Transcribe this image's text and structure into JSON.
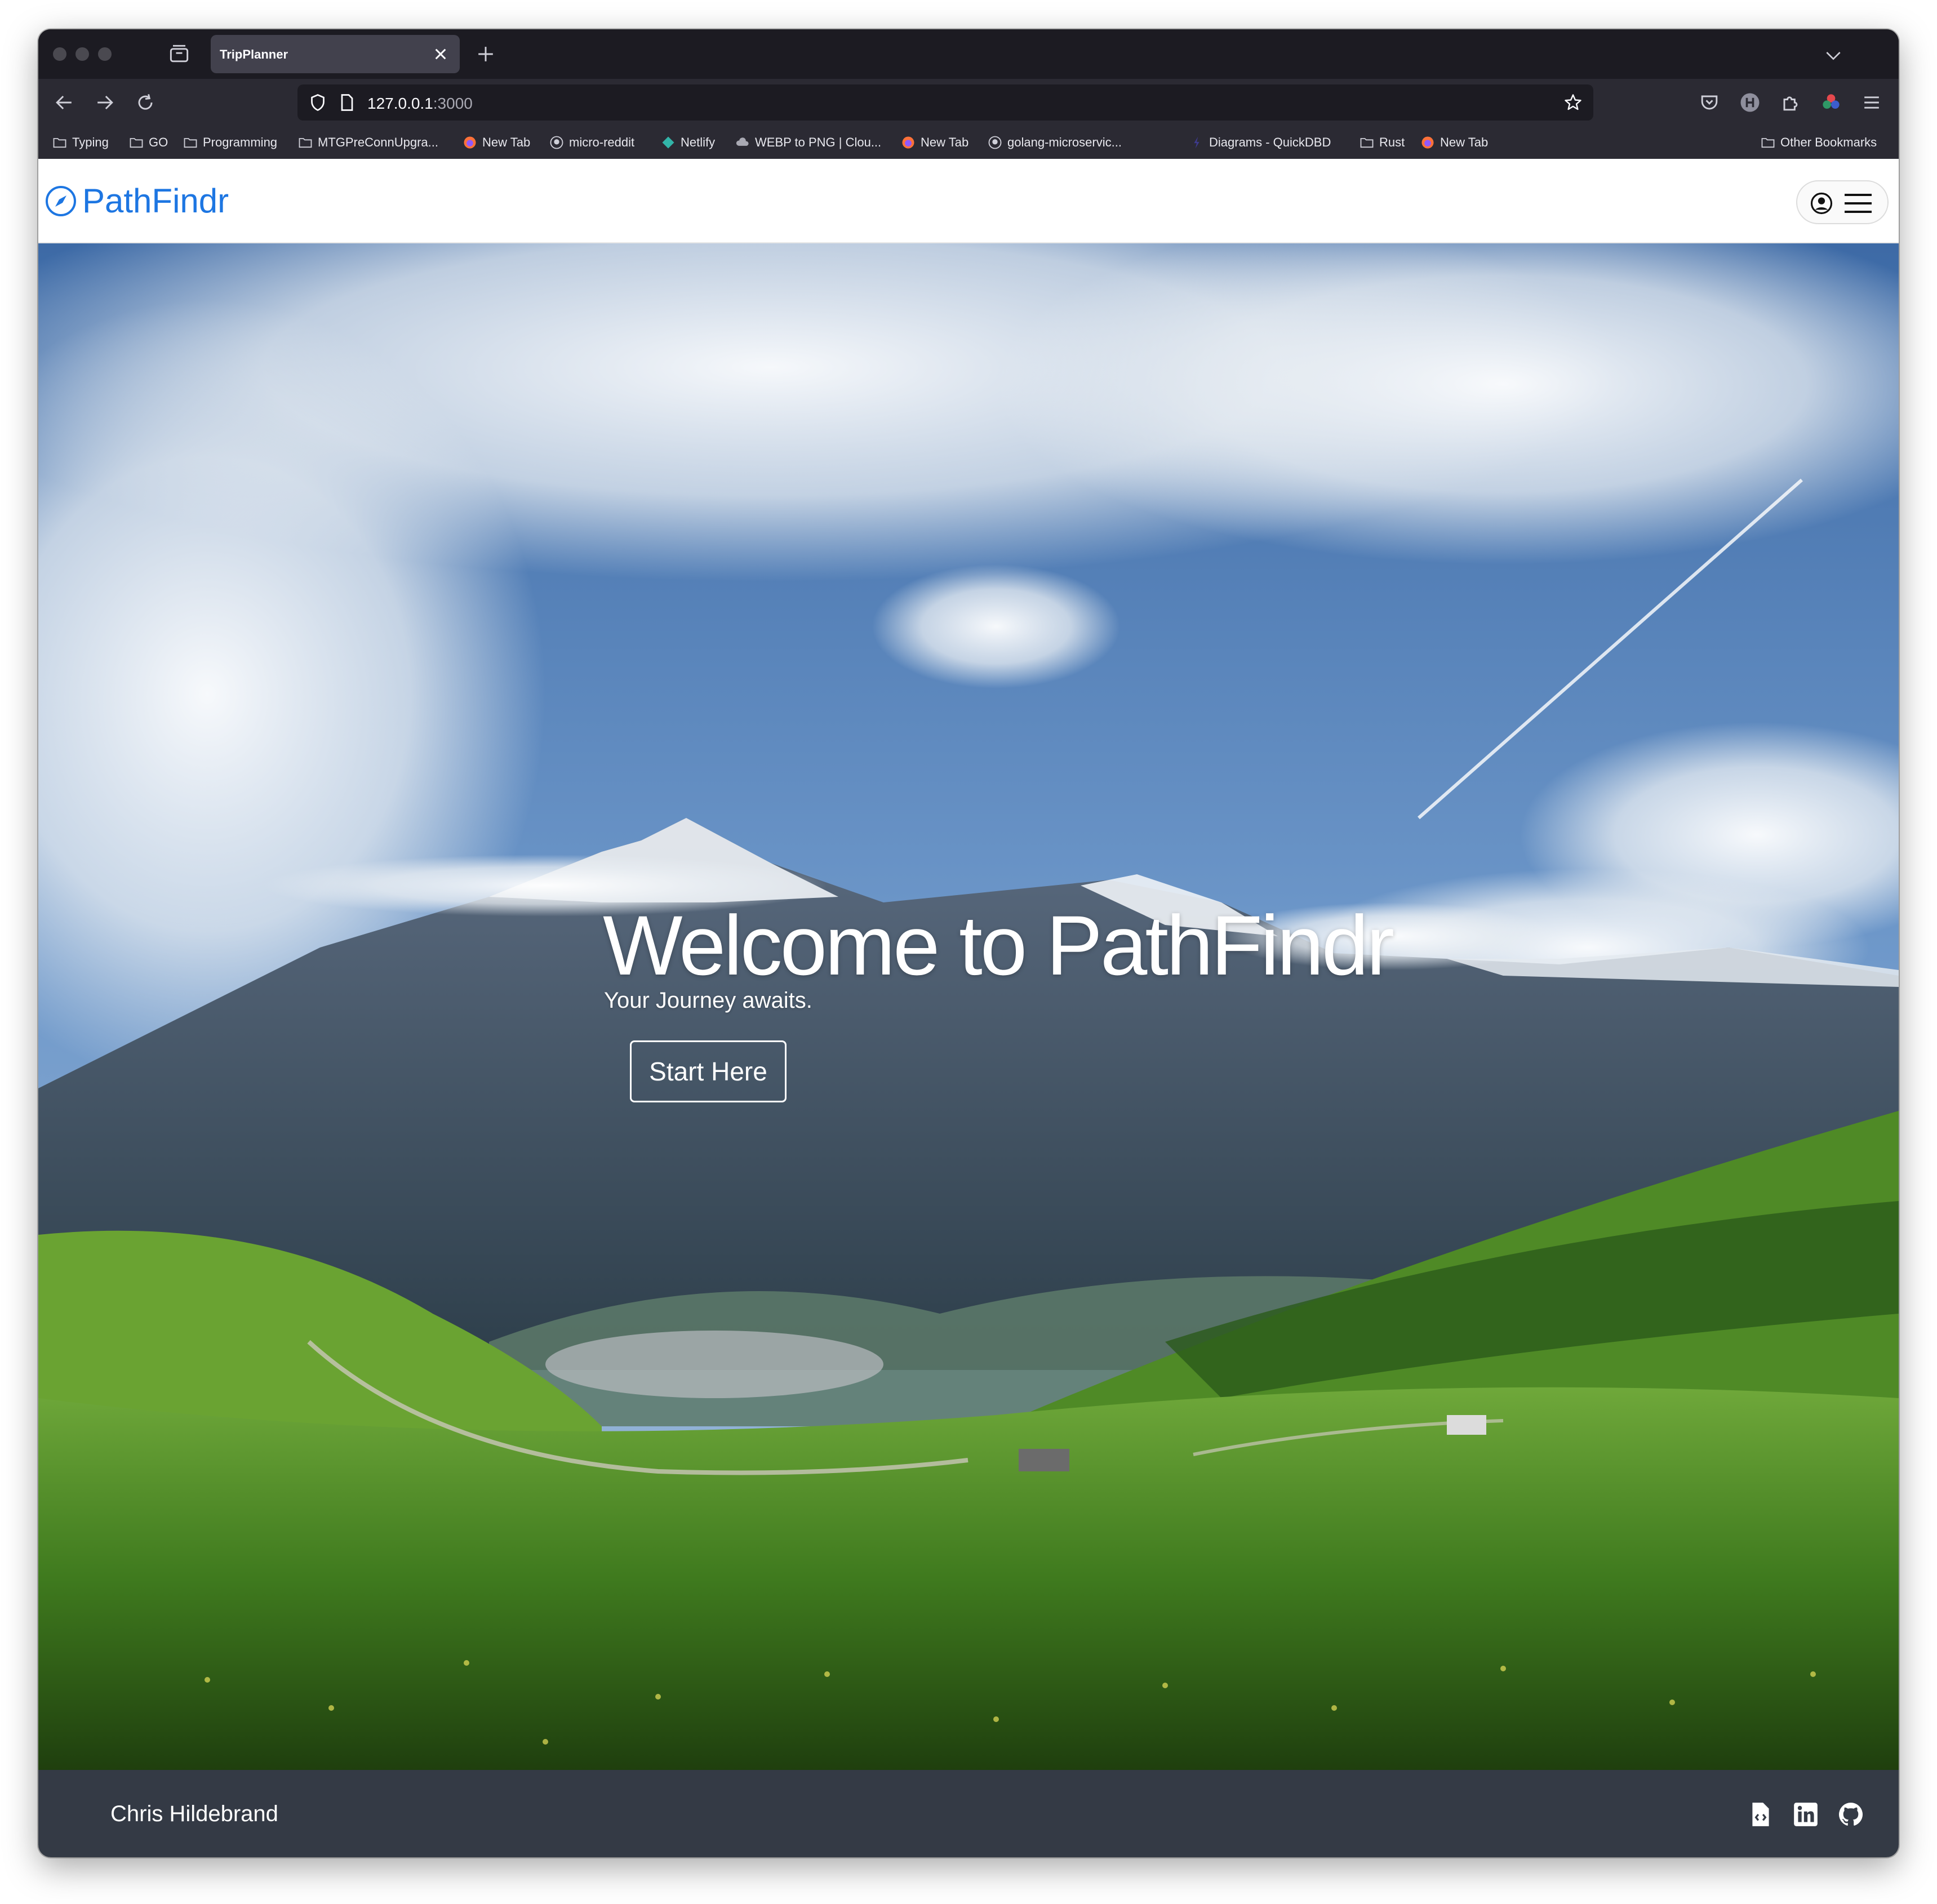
{
  "browser": {
    "tab_title": "TripPlanner",
    "url_host": "127.0.0.1",
    "url_port": ":3000",
    "bookmarks": [
      {
        "label": "Typing",
        "icon": "folder-icon"
      },
      {
        "label": "GO",
        "icon": "folder-icon"
      },
      {
        "label": "Programming",
        "icon": "folder-icon"
      },
      {
        "label": "MTGPreConnUpgra...",
        "icon": "folder-icon"
      },
      {
        "label": "New Tab",
        "icon": "firefox-icon"
      },
      {
        "label": "micro-reddit",
        "icon": "github-icon"
      },
      {
        "label": "Netlify",
        "icon": "netlify-icon"
      },
      {
        "label": "WEBP to PNG | Clou...",
        "icon": "cloud-icon"
      },
      {
        "label": "New Tab",
        "icon": "firefox-icon"
      },
      {
        "label": "golang-microservic...",
        "icon": "github-icon"
      },
      {
        "label": "Diagrams - QuickDBD",
        "icon": "quickdbd-icon"
      },
      {
        "label": "Rust",
        "icon": "folder-icon"
      },
      {
        "label": "New Tab",
        "icon": "firefox-icon"
      }
    ],
    "other_bookmarks": "Other Bookmarks"
  },
  "header": {
    "brand": "PathFindr",
    "brand_color": "#1d76e2"
  },
  "hero": {
    "title": "Welcome to PathFindr",
    "subtitle": "Your Journey awaits.",
    "cta_label": "Start Here"
  },
  "footer": {
    "author": "Chris Hildebrand",
    "links": [
      "file-code-icon",
      "linkedin-icon",
      "github-icon"
    ],
    "background": "#343a45"
  }
}
